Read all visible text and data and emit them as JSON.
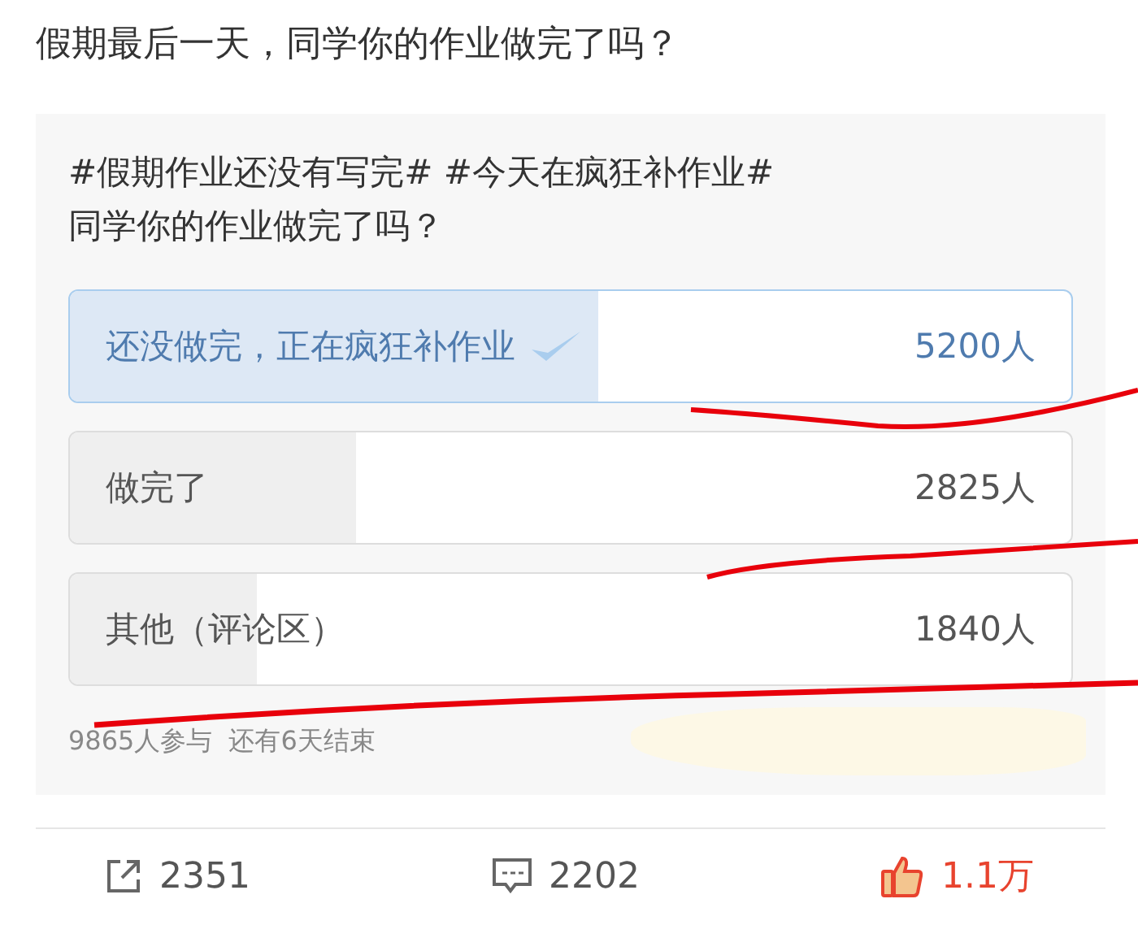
{
  "post": {
    "text": "假期最后一天，同学你的作业做完了吗？"
  },
  "poll": {
    "title": "#假期作业还没有写完# #今天在疯狂补作业#\n同学你的作业做完了吗？",
    "options": [
      {
        "label": "还没做完，正在疯狂补作业",
        "count": "5200人",
        "level": 0.527,
        "selected": true
      },
      {
        "label": "做完了",
        "count": "2825人",
        "level": 0.286,
        "selected": false
      },
      {
        "label": "其他（评论区）",
        "count": "1840人",
        "level": 0.187,
        "selected": false
      }
    ],
    "participants": "9865人参与",
    "remaining": "还有6天结束"
  },
  "actions": [
    {
      "kind": "share",
      "count": "2351"
    },
    {
      "kind": "comment",
      "count": "2202"
    },
    {
      "kind": "like",
      "count": "1.1万"
    }
  ]
}
